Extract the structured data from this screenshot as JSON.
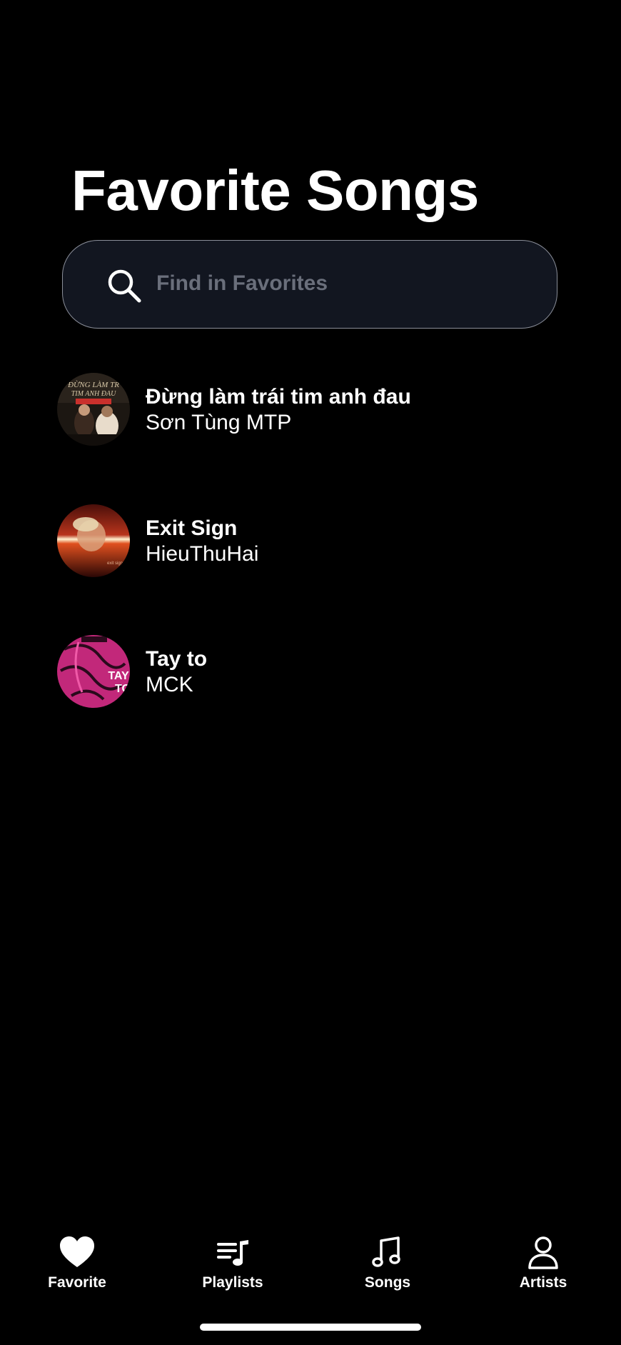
{
  "header": {
    "title": "Favorite Songs"
  },
  "search": {
    "placeholder": "Find in Favorites",
    "value": "",
    "icon": "search-icon"
  },
  "songs": [
    {
      "title": "Đừng làm trái tim anh đau",
      "artist": "Sơn Tùng MTP",
      "artwork_icon": "album-art-dung-lam-trai-tim-anh-dau"
    },
    {
      "title": "Exit Sign",
      "artist": "HieuThuHai",
      "artwork_icon": "album-art-exit-sign"
    },
    {
      "title": "Tay to",
      "artist": "MCK",
      "artwork_icon": "album-art-tay-to"
    }
  ],
  "tabs": [
    {
      "label": "Favorite",
      "icon": "heart-icon"
    },
    {
      "label": "Playlists",
      "icon": "playlist-icon"
    },
    {
      "label": "Songs",
      "icon": "music-note-icon"
    },
    {
      "label": "Artists",
      "icon": "person-icon"
    }
  ],
  "colors": {
    "background": "#000000",
    "search_background": "#121620",
    "search_border": "#8a8e99",
    "placeholder": "#6a6f7b",
    "text": "#ffffff"
  }
}
